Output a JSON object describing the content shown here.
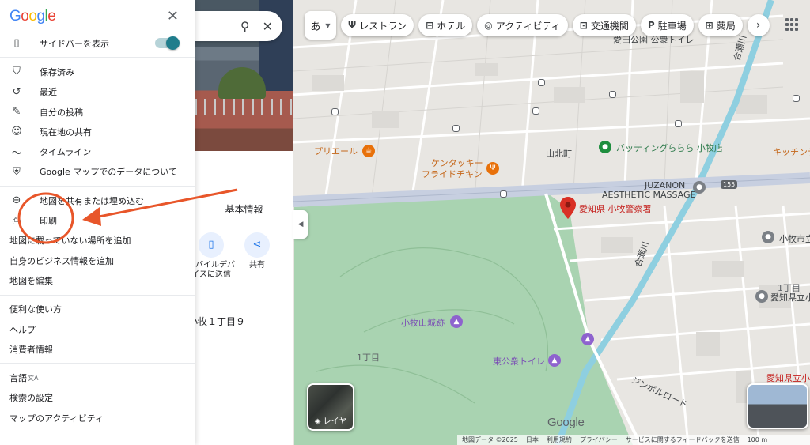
{
  "sidebar": {
    "logo": [
      "G",
      "o",
      "o",
      "g",
      "l",
      "e"
    ],
    "close_label": "✕",
    "show_sidebar": {
      "label": "サイドバーを表示",
      "enabled": true
    },
    "group1": [
      {
        "id": "saved",
        "label": "保存済み",
        "icon": "bookmark-icon"
      },
      {
        "id": "recent",
        "label": "最近",
        "icon": "history-icon"
      },
      {
        "id": "contributions",
        "label": "自分の投稿",
        "icon": "contributions-icon"
      },
      {
        "id": "location-sharing",
        "label": "現在地の共有",
        "icon": "location-sharing-icon"
      },
      {
        "id": "timeline",
        "label": "タイムライン",
        "icon": "timeline-icon"
      },
      {
        "id": "your-data",
        "label": "Google マップでのデータについて",
        "icon": "shield-icon"
      }
    ],
    "group2": [
      {
        "id": "share-embed",
        "label": "地図を共有または埋め込む",
        "icon": "link-icon"
      },
      {
        "id": "print",
        "label": "印刷",
        "icon": "print-icon"
      },
      {
        "id": "add-missing-place",
        "label": "地図に載っていない場所を追加"
      },
      {
        "id": "add-business",
        "label": "自身のビジネス情報を追加"
      },
      {
        "id": "edit-map",
        "label": "地図を編集"
      }
    ],
    "group3": [
      {
        "id": "tips",
        "label": "便利な使い方"
      },
      {
        "id": "help",
        "label": "ヘルプ"
      },
      {
        "id": "consumer-info",
        "label": "消費者情報"
      }
    ],
    "group4": [
      {
        "id": "language",
        "label": "言語",
        "suffix": "文A"
      },
      {
        "id": "search-settings",
        "label": "検索の設定"
      },
      {
        "id": "maps-activity",
        "label": "マップのアクティビティ"
      }
    ]
  },
  "place_panel": {
    "tab_basic": "基本情報",
    "actions": [
      {
        "id": "send-to-phone",
        "label": "モバイルデバイスに送信",
        "icon": "phone-send-icon"
      },
      {
        "id": "share",
        "label": "共有",
        "icon": "share-icon"
      }
    ],
    "address_fragment": "小牧１丁目９"
  },
  "chips": {
    "lang": "あ",
    "items": [
      {
        "id": "restaurant",
        "label": "レストラン",
        "icon": "restaurant-icon"
      },
      {
        "id": "hotel",
        "label": "ホテル",
        "icon": "hotel-icon"
      },
      {
        "id": "activity",
        "label": "アクティビティ",
        "icon": "camera-icon"
      },
      {
        "id": "transit",
        "label": "交通機関",
        "icon": "transit-icon"
      },
      {
        "id": "parking",
        "label": "駐車場",
        "icon": "parking-icon"
      },
      {
        "id": "pharmacy",
        "label": "薬局",
        "icon": "pharmacy-icon"
      }
    ]
  },
  "map": {
    "labels": {
      "pin": "愛知県 小牧警察署",
      "prieru": "プリエール",
      "kfc_line1": "ケンタッキー",
      "kfc_line2": "フライドチキン",
      "sanpoku": "山北町",
      "batting": "バッティングららら 小牧店",
      "kitchen": "キッチンテ",
      "juzanon_line1": "JUZANON",
      "juzanon_line2": "AESTHETIC MASSAGE",
      "komaki_city": "小牧市立",
      "itchome_r": "1丁目",
      "aichi_r1": "愛知県立小",
      "castle": "小牧山城跡",
      "itchome_l": "1丁目",
      "toilet": "東公衆トイレ",
      "aichi_r2": "愛知県立小",
      "jin_road": "ジンボルロード",
      "park_top": "愛田公園 公衆トイレ",
      "river": "合瀬川",
      "river2": "合瀬川",
      "route155": "155"
    },
    "layers_label": "レイヤ",
    "watermark": "Google",
    "footer": [
      "地図データ ©2025",
      "日本",
      "利用規約",
      "プライバシー",
      "サービスに関するフィードバックを送信",
      "100 m"
    ]
  },
  "colors": {
    "accent": "#1f7d8c",
    "annotation": "#e8562a",
    "pin": "#c5221f",
    "park": "#a8d5b0"
  }
}
